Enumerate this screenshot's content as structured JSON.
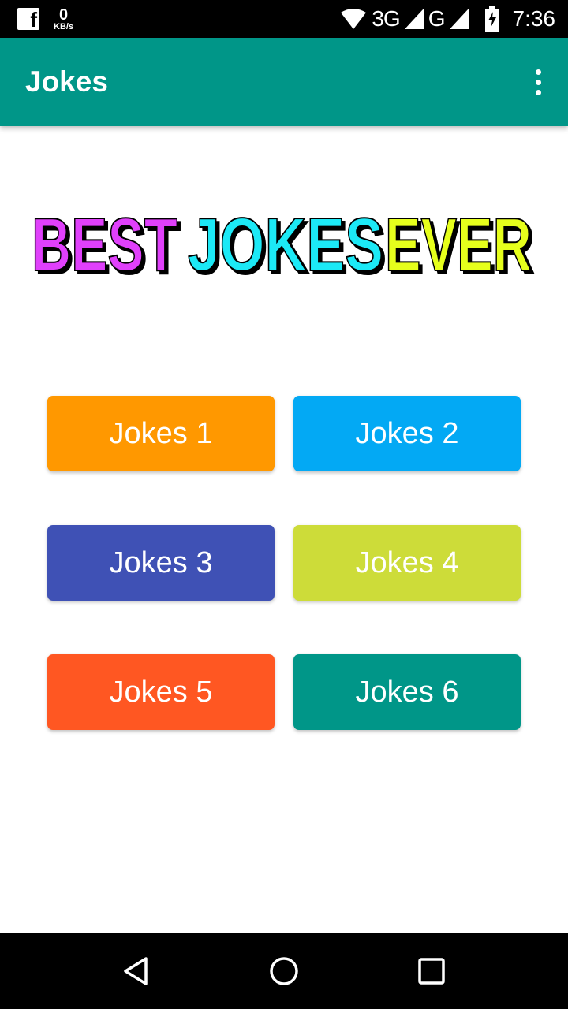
{
  "status_bar": {
    "net_speed_value": "0",
    "net_speed_unit": "KB/s",
    "network_label": "3G",
    "network_label_2": "G",
    "time": "7:36",
    "icons": [
      "facebook-icon",
      "wifi-icon",
      "signal-icon",
      "battery-charging-icon"
    ]
  },
  "app_bar": {
    "title": "Jokes",
    "overflow_icon": "more-vert-icon",
    "background": "#009688"
  },
  "banner": {
    "word1": "BEST",
    "word2": "JOKES",
    "word3": "EVER",
    "colors": [
      "#e040fb",
      "#1de9f6",
      "#e6ff1f"
    ]
  },
  "buttons": [
    {
      "label": "Jokes 1",
      "color": "#FF9800"
    },
    {
      "label": "Jokes 2",
      "color": "#03A9F4"
    },
    {
      "label": "Jokes 3",
      "color": "#3F51B5"
    },
    {
      "label": "Jokes 4",
      "color": "#CDDC39"
    },
    {
      "label": "Jokes 5",
      "color": "#FF5722"
    },
    {
      "label": "Jokes 6",
      "color": "#009688"
    }
  ],
  "nav_bar": {
    "icons": [
      "back-icon",
      "home-icon",
      "recents-icon"
    ]
  }
}
